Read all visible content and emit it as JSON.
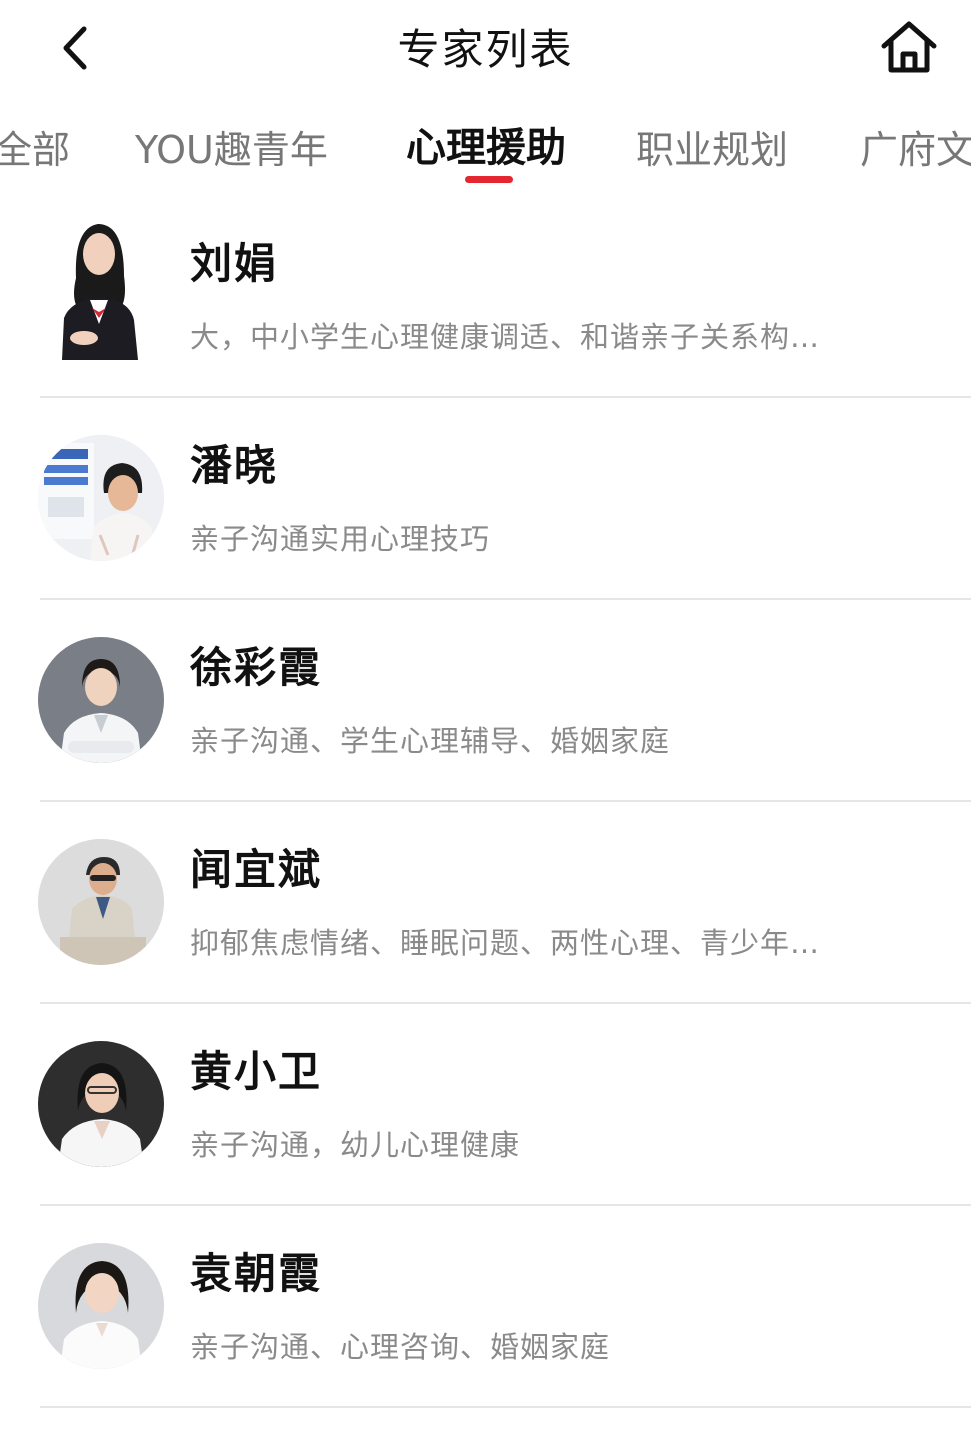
{
  "header": {
    "title": "专家列表",
    "back_icon": "chevron-left-icon",
    "home_icon": "home-icon"
  },
  "tabs": [
    {
      "label": "全部"
    },
    {
      "label": "YOU趣青年"
    },
    {
      "label": "心理援助",
      "active": true
    },
    {
      "label": "职业规划"
    },
    {
      "label": "广府文"
    }
  ],
  "accent_color": "#e3262f",
  "experts": [
    {
      "name": "刘娟",
      "desc": "大，中小学生心理健康调适、和谐亲子关系构…"
    },
    {
      "name": "潘晓",
      "desc": "亲子沟通实用心理技巧"
    },
    {
      "name": "徐彩霞",
      "desc": "亲子沟通、学生心理辅导、婚姻家庭"
    },
    {
      "name": "闻宜斌",
      "desc": "抑郁焦虑情绪、睡眠问题、两性心理、青少年…"
    },
    {
      "name": "黄小卫",
      "desc": "亲子沟通，幼儿心理健康"
    },
    {
      "name": "袁朝霞",
      "desc": "亲子沟通、心理咨询、婚姻家庭"
    }
  ]
}
